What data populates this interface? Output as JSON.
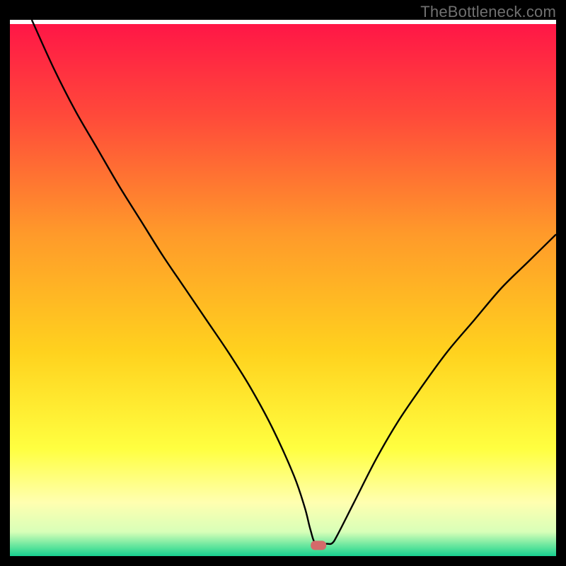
{
  "watermark": "TheBottleneck.com",
  "chart_data": {
    "type": "line",
    "title": "",
    "xlabel": "",
    "ylabel": "",
    "xlim": [
      0,
      100
    ],
    "ylim": [
      0,
      100
    ],
    "grid": false,
    "legend": false,
    "background_gradient_stops": [
      {
        "pos": 0.0,
        "color": "#ff1447"
      },
      {
        "pos": 0.18,
        "color": "#ff4a3a"
      },
      {
        "pos": 0.4,
        "color": "#ff9a2a"
      },
      {
        "pos": 0.62,
        "color": "#ffd21e"
      },
      {
        "pos": 0.8,
        "color": "#ffff40"
      },
      {
        "pos": 0.9,
        "color": "#ffffb0"
      },
      {
        "pos": 0.955,
        "color": "#d8ffb8"
      },
      {
        "pos": 0.985,
        "color": "#55e29a"
      },
      {
        "pos": 1.0,
        "color": "#18cf90"
      }
    ],
    "background_gradient_top_white_band": true,
    "marker": {
      "x": 56.5,
      "y": 2.0,
      "color": "#d46a6a"
    },
    "series": [
      {
        "name": "curve",
        "color": "#000000",
        "width": 2.4,
        "x": [
          4.0,
          8.0,
          12.0,
          16.0,
          20.0,
          24.0,
          28.0,
          32.0,
          36.0,
          40.0,
          44.0,
          48.0,
          52.0,
          54.0,
          55.0,
          56.0,
          58.0,
          59.0,
          60.0,
          63.0,
          67.0,
          71.0,
          75.0,
          80.0,
          85.0,
          90.0,
          95.0,
          100.0
        ],
        "y": [
          100.0,
          91.0,
          83.0,
          76.0,
          69.0,
          62.5,
          56.0,
          50.0,
          44.0,
          38.0,
          31.5,
          24.0,
          15.0,
          9.0,
          5.0,
          2.3,
          2.3,
          2.4,
          4.0,
          10.0,
          18.0,
          25.0,
          31.0,
          38.0,
          44.0,
          50.0,
          55.0,
          60.0
        ]
      }
    ]
  }
}
